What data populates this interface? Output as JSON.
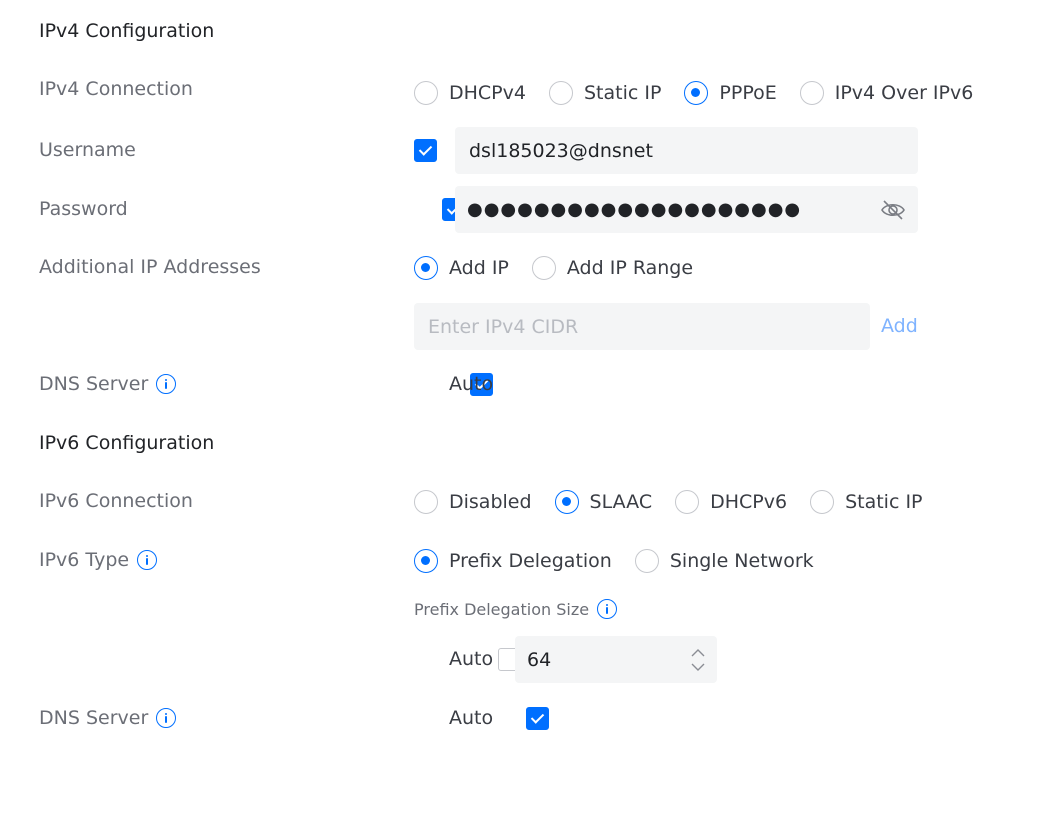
{
  "ipv4": {
    "title": "IPv4 Configuration",
    "connection": {
      "label": "IPv4 Connection",
      "options": [
        "DHCPv4",
        "Static IP",
        "PPPoE",
        "IPv4 Over IPv6"
      ],
      "selected": "PPPoE"
    },
    "username": {
      "label": "Username",
      "value": "dsl185023@dnsnet",
      "checked": true
    },
    "password": {
      "label": "Password",
      "masked": "●●●●●●●●●●●●●●●●●●●●",
      "checked": true
    },
    "additional_ip": {
      "label": "Additional IP Addresses",
      "options": [
        "Add IP",
        "Add IP Range"
      ],
      "selected": "Add IP",
      "placeholder": "Enter IPv4 CIDR",
      "add_label": "Add"
    },
    "dns": {
      "label": "DNS Server",
      "auto_label": "Auto",
      "checked": true
    }
  },
  "ipv6": {
    "title": "IPv6 Configuration",
    "connection": {
      "label": "IPv6 Connection",
      "options": [
        "Disabled",
        "SLAAC",
        "DHCPv6",
        "Static IP"
      ],
      "selected": "SLAAC"
    },
    "type": {
      "label": "IPv6 Type",
      "options": [
        "Prefix Delegation",
        "Single Network"
      ],
      "selected": "Prefix Delegation"
    },
    "prefix_size": {
      "label": "Prefix Delegation Size",
      "auto_label": "Auto",
      "auto_checked": false,
      "value": "64"
    },
    "dns": {
      "label": "DNS Server",
      "auto_label": "Auto",
      "checked": true
    }
  },
  "icons": {
    "info": "info-icon",
    "eye": "eye-off-icon",
    "up": "chevron-up-icon",
    "down": "chevron-down-icon"
  },
  "colors": {
    "accent": "#006fff",
    "label": "#6b6e76",
    "field_bg": "#f4f5f6"
  }
}
